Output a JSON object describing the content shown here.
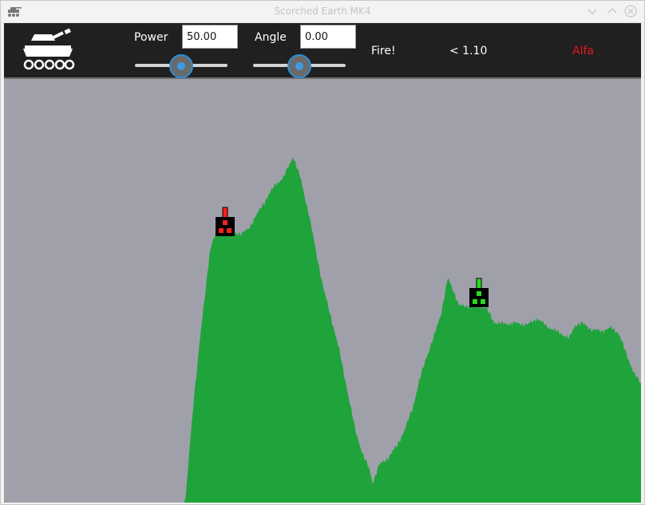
{
  "window": {
    "title": "Scorched Earth MK4"
  },
  "toolbar": {
    "power_label": "Power",
    "power_value": "50.00",
    "angle_label": "Angle",
    "angle_value": "0.00",
    "fire_label": "Fire!",
    "wind_text": "< 1.10",
    "current_player": "Alfa",
    "current_player_color": "#e8161b"
  },
  "sliders": {
    "power_fraction": 0.5,
    "angle_fraction": 0.5
  },
  "field": {
    "sky_color": "#a0a0ab",
    "terrain_color": "#1fa33b",
    "tanks": [
      {
        "name": "red",
        "color": "#ff2020",
        "barrel_angle_deg": 90
      },
      {
        "name": "green",
        "color": "#22dd22",
        "barrel_angle_deg": 90
      }
    ]
  }
}
